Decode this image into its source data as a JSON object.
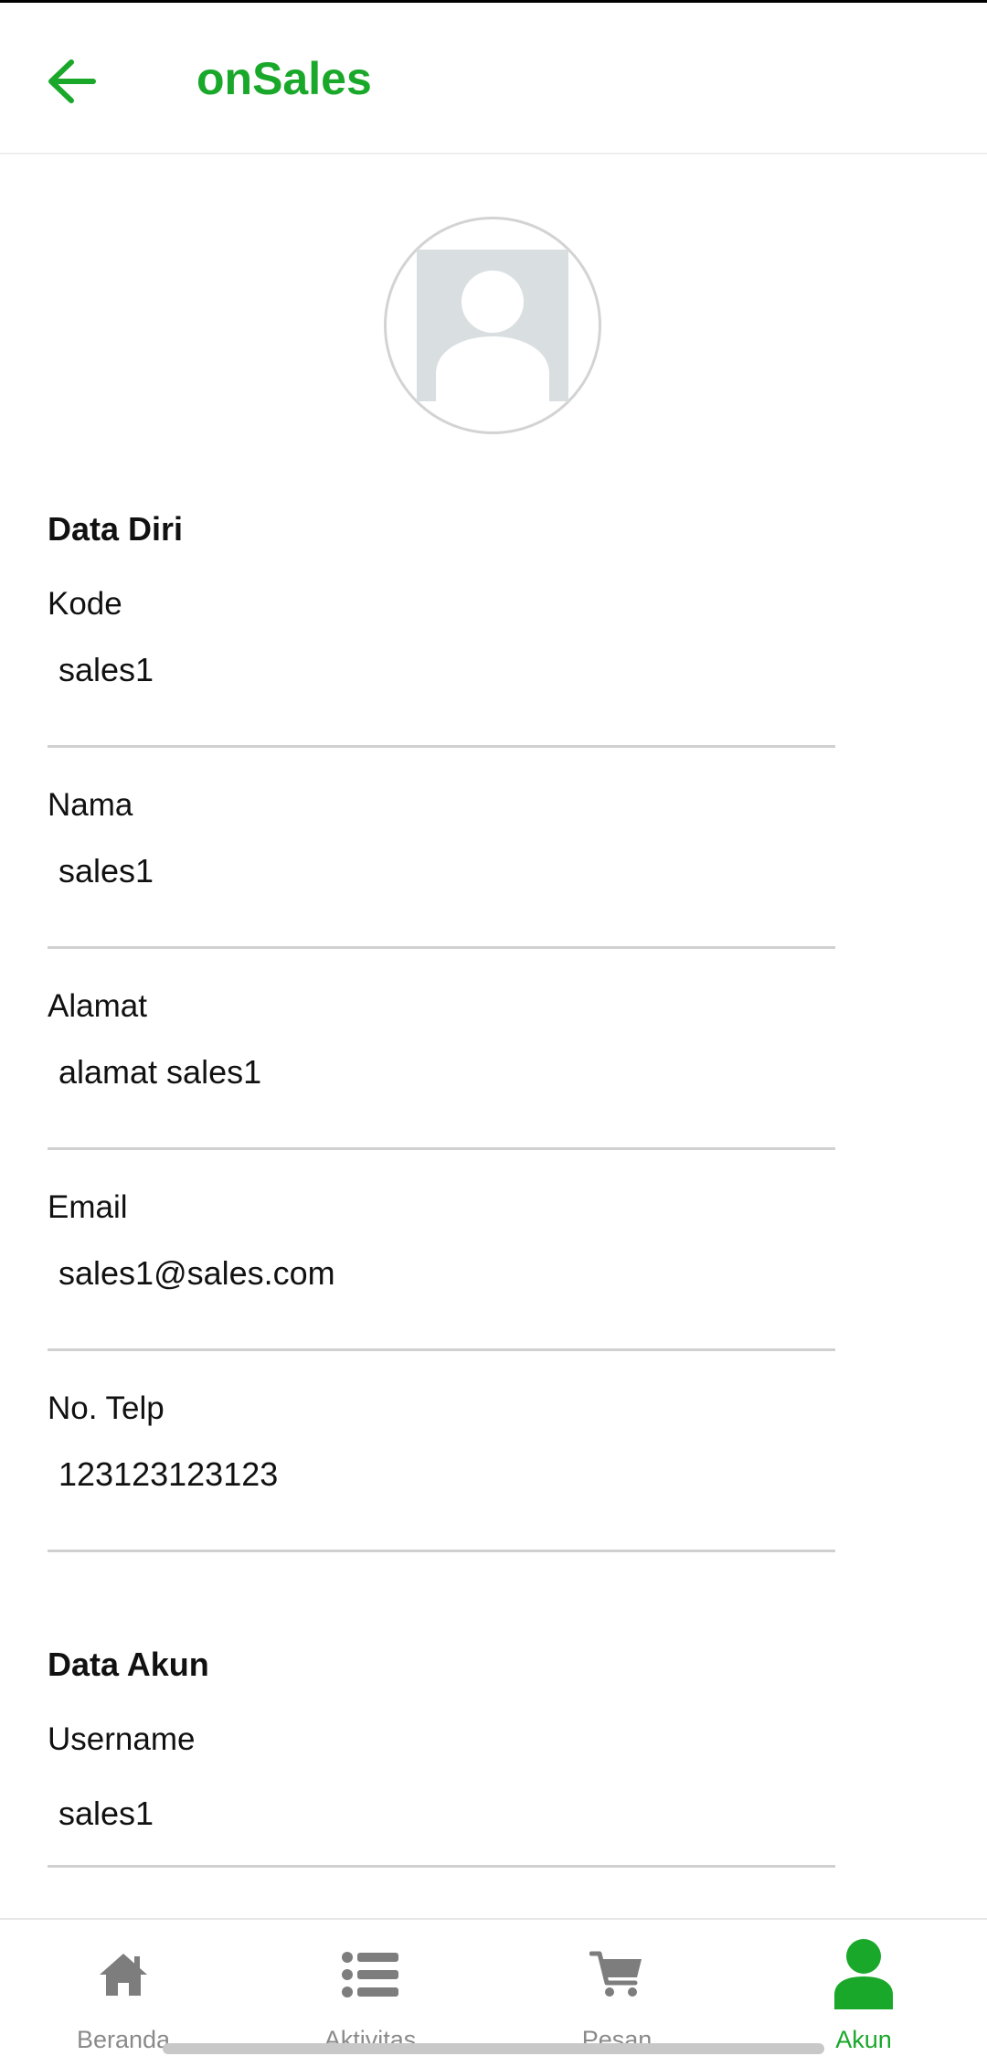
{
  "app_bar": {
    "title": "onSales",
    "back_icon": "arrow-left-icon"
  },
  "profile": {
    "avatar_icon": "user-placeholder-icon"
  },
  "data_diri": {
    "title": "Data Diri",
    "fields": [
      {
        "label": "Kode",
        "value": "sales1"
      },
      {
        "label": "Nama",
        "value": "sales1"
      },
      {
        "label": "Alamat",
        "value": "alamat sales1"
      },
      {
        "label": "Email",
        "value": "sales1@sales.com"
      },
      {
        "label": "No. Telp",
        "value": "123123123123"
      }
    ]
  },
  "data_akun": {
    "title": "Data Akun",
    "fields": [
      {
        "label": "Username",
        "value": "sales1"
      }
    ]
  },
  "bottom_nav": {
    "items": [
      {
        "label": "Beranda",
        "icon": "home-icon",
        "active": false
      },
      {
        "label": "Aktivitas",
        "icon": "list-icon",
        "active": false
      },
      {
        "label": "Pesan",
        "icon": "cart-icon",
        "active": false
      },
      {
        "label": "Akun",
        "icon": "user-icon",
        "active": true
      }
    ]
  },
  "colors": {
    "accent": "#1aa82b",
    "inactive": "#8a8a8a",
    "divider": "#d0d0d0"
  }
}
